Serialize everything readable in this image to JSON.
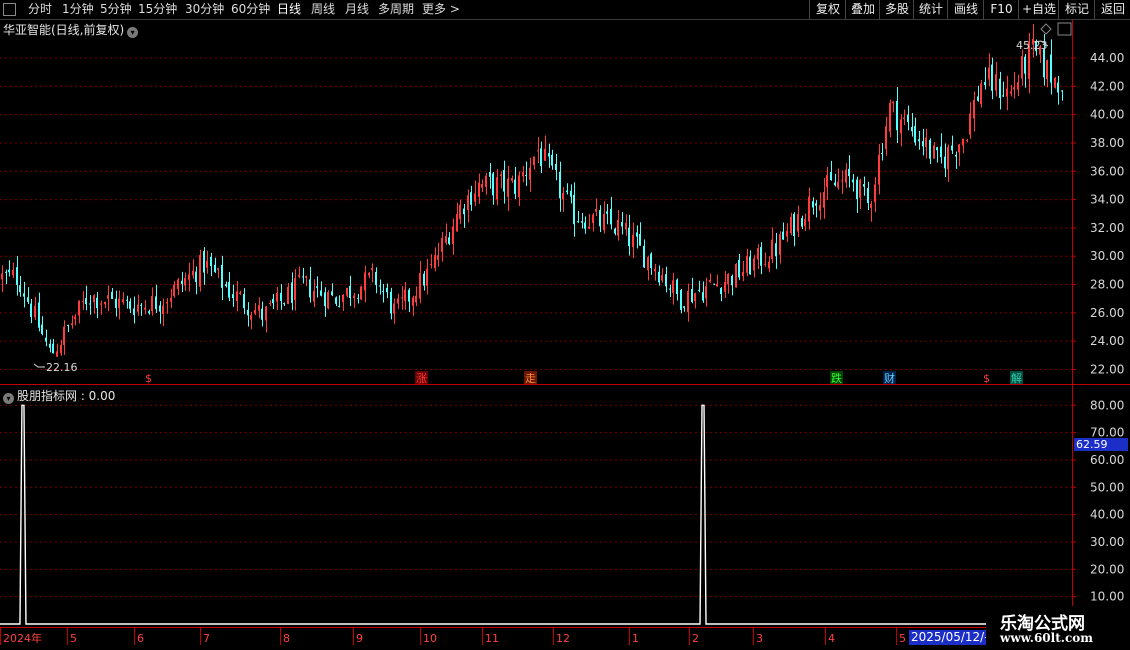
{
  "toolbar": {
    "periods": [
      "分时",
      "1分钟",
      "5分钟",
      "15分钟",
      "30分钟",
      "60分钟",
      "日线",
      "周线",
      "月线",
      "多周期",
      "更多 >"
    ],
    "active_period": "日线",
    "right_buttons": [
      "复权",
      "叠加",
      "多股",
      "统计",
      "画线",
      "F10",
      "+自选",
      "返回"
    ]
  },
  "chart_title": "华亚智能(日线,前复权)",
  "indicator_title": "股朋指标网 : 0.00",
  "price_axis": {
    "labels": [
      "44.00",
      "42.00",
      "40.00",
      "38.00",
      "36.00",
      "34.00",
      "32.00",
      "30.00",
      "28.00",
      "26.00",
      "24.00",
      "22.00"
    ]
  },
  "indicator_axis": {
    "labels": [
      "80.00",
      "70.00",
      "60.00",
      "50.00",
      "40.00",
      "30.00",
      "20.00",
      "10.00"
    ]
  },
  "indicator_current": "62.59",
  "max_label": "45.23",
  "min_label": "22.16",
  "event_markers": [
    "$",
    "涨",
    "走",
    "跌",
    "财",
    "$",
    "解"
  ],
  "date_axis": [
    "2024年",
    "5",
    "6",
    "7",
    "8",
    "9",
    "10",
    "11",
    "12",
    "1",
    "2",
    "3",
    "4",
    "5"
  ],
  "date_current": "2025/05/12/-",
  "logo": {
    "line1": "乐淘公式网",
    "line2": "www.60lt.com"
  },
  "colors": {
    "up": "#ff3b3b",
    "down": "#54ffff",
    "grid": "#7a0000",
    "axis": "#c00000"
  },
  "chart_data": {
    "type": "candlestick",
    "y_range": [
      21.2,
      45.5
    ],
    "max": 45.23,
    "min": 22.16,
    "close_path": [
      {
        "date": "2024-04-01",
        "close": 28.5
      },
      {
        "date": "2024-04-15",
        "close": 23.0
      },
      {
        "date": "2024-05-01",
        "close": 27.2
      },
      {
        "date": "2024-05-20",
        "close": 26.5
      },
      {
        "date": "2024-06-01",
        "close": 26.8
      },
      {
        "date": "2024-06-20",
        "close": 29.5
      },
      {
        "date": "2024-07-01",
        "close": 27.5
      },
      {
        "date": "2024-07-15",
        "close": 25.8
      },
      {
        "date": "2024-08-01",
        "close": 28.0
      },
      {
        "date": "2024-08-15",
        "close": 27.0
      },
      {
        "date": "2024-09-01",
        "close": 28.5
      },
      {
        "date": "2024-09-10",
        "close": 26.0
      },
      {
        "date": "2024-09-25",
        "close": 29.0
      },
      {
        "date": "2024-10-08",
        "close": 33.5
      },
      {
        "date": "2024-10-15",
        "close": 35.0
      },
      {
        "date": "2024-11-01",
        "close": 35.0
      },
      {
        "date": "2024-11-10",
        "close": 37.5
      },
      {
        "date": "2024-11-25",
        "close": 33.0
      },
      {
        "date": "2024-12-15",
        "close": 32.0
      },
      {
        "date": "2025-01-01",
        "close": 29.0
      },
      {
        "date": "2025-01-10",
        "close": 27.0
      },
      {
        "date": "2025-02-01",
        "close": 28.5
      },
      {
        "date": "2025-02-20",
        "close": 30.5
      },
      {
        "date": "2025-03-10",
        "close": 34.5
      },
      {
        "date": "2025-03-25",
        "close": 35.5
      },
      {
        "date": "2025-04-01",
        "close": 33.5
      },
      {
        "date": "2025-04-10",
        "close": 40.5
      },
      {
        "date": "2025-04-25",
        "close": 38.0
      },
      {
        "date": "2025-05-01",
        "close": 36.5
      },
      {
        "date": "2025-05-12",
        "close": 38.5
      },
      {
        "date": "2025-05-20",
        "close": 42.5
      },
      {
        "date": "2025-06-01",
        "close": 41.5
      },
      {
        "date": "2025-06-10",
        "close": 44.5
      },
      {
        "date": "2025-06-20",
        "close": 42.5
      }
    ],
    "indicator": {
      "y_range": [
        0,
        84
      ],
      "spikes": [
        {
          "date": "2024-04-03",
          "value": 80
        },
        {
          "date": "2025-01-20",
          "value": 80
        }
      ]
    }
  }
}
